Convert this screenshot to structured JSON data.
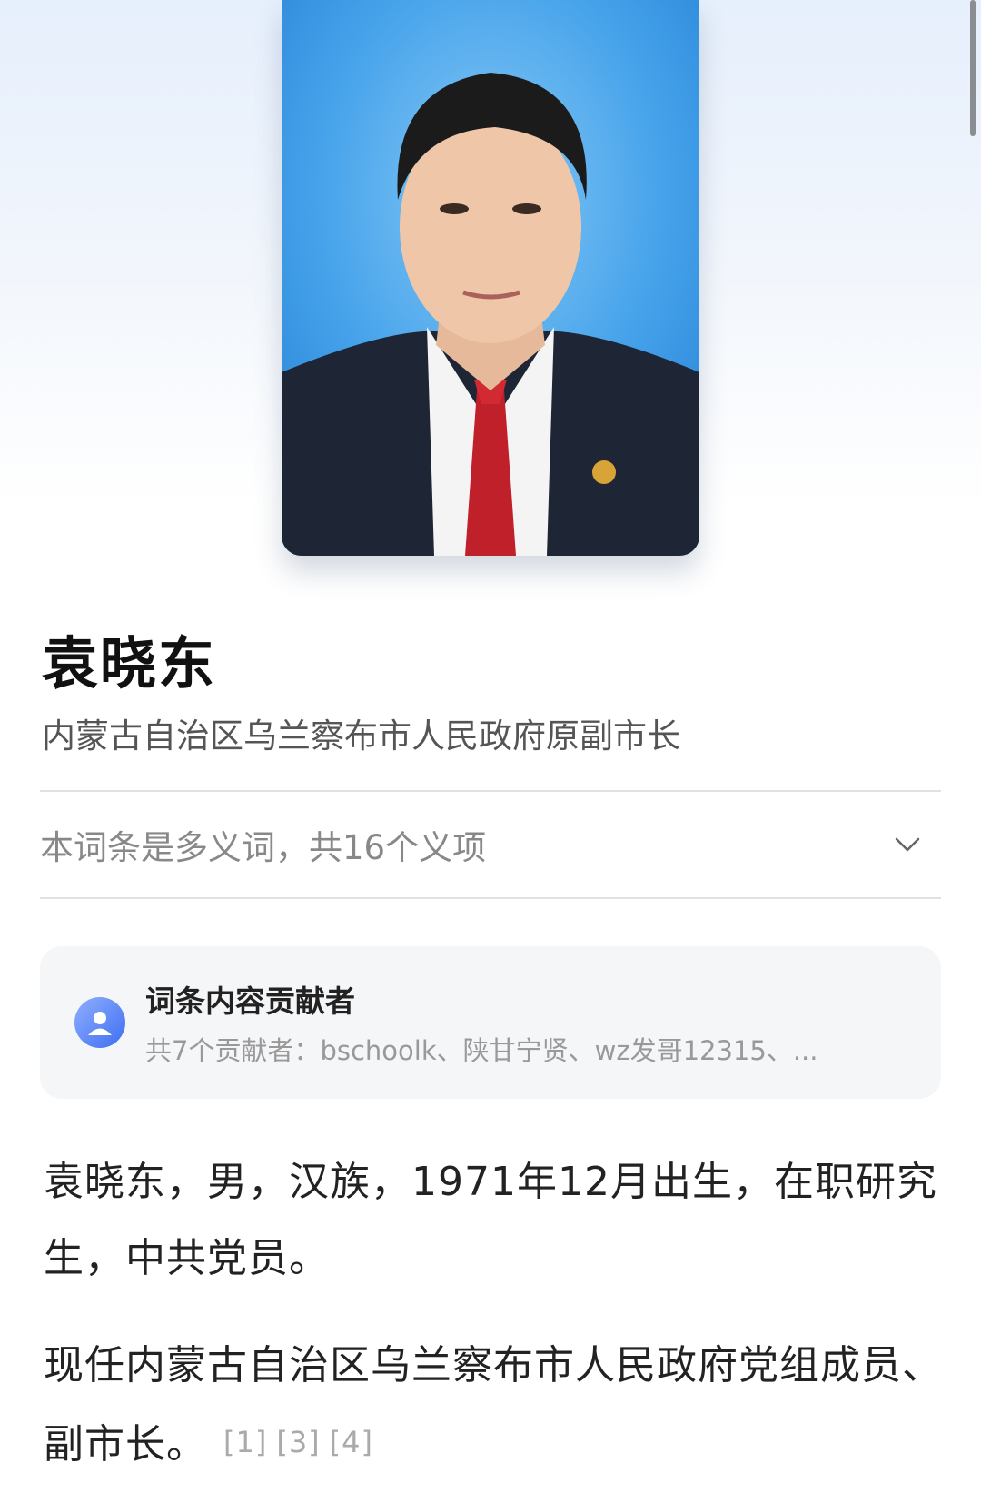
{
  "entry": {
    "title": "袁晓东",
    "subtitle": "内蒙古自治区乌兰察布市人民政府原副市长"
  },
  "polysemy": {
    "text": "本词条是多义词，共16个义项"
  },
  "contributors": {
    "title": "词条内容贡献者",
    "summary": "共7个贡献者：bschoolk、陕甘宁贤、wz发哥12315、..."
  },
  "body": {
    "paragraph1": "袁晓东，男，汉族，1971年12月出生，在职研究生，中共党员。",
    "paragraph2": "现任内蒙古自治区乌兰察布市人民政府党组成员、副市长。",
    "citations": [
      "[1]",
      "[3]",
      "[4]"
    ]
  },
  "icons": {
    "expand": "chevron-down-icon",
    "contributor": "user-avatar-icon"
  }
}
